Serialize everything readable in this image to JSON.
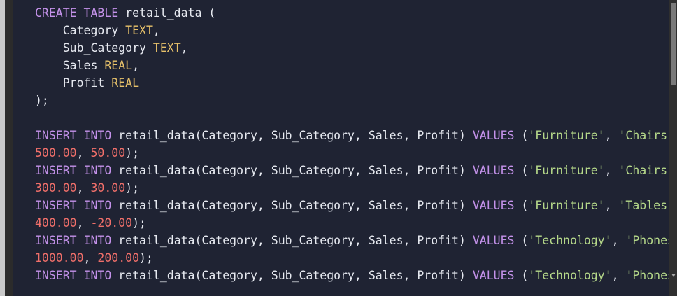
{
  "editor": {
    "lines": [
      [
        {
          "t": "CREATE TABLE ",
          "c": "kw"
        },
        {
          "t": "retail_data (",
          "c": ""
        }
      ],
      [
        {
          "t": "    Category ",
          "c": ""
        },
        {
          "t": "TEXT",
          "c": "ty"
        },
        {
          "t": ",",
          "c": ""
        }
      ],
      [
        {
          "t": "    Sub_Category ",
          "c": ""
        },
        {
          "t": "TEXT",
          "c": "ty"
        },
        {
          "t": ",",
          "c": ""
        }
      ],
      [
        {
          "t": "    Sales ",
          "c": ""
        },
        {
          "t": "REAL",
          "c": "ty"
        },
        {
          "t": ",",
          "c": ""
        }
      ],
      [
        {
          "t": "    Profit ",
          "c": ""
        },
        {
          "t": "REAL",
          "c": "ty"
        }
      ],
      [
        {
          "t": ");",
          "c": ""
        }
      ],
      [
        {
          "t": "",
          "c": ""
        }
      ],
      [
        {
          "t": "INSERT INTO ",
          "c": "kw"
        },
        {
          "t": "retail_data(Category, Sub_Category, Sales, Profit) ",
          "c": ""
        },
        {
          "t": "VALUES",
          "c": "kw"
        },
        {
          "t": " (",
          "c": ""
        },
        {
          "t": "'Furniture'",
          "c": "str"
        },
        {
          "t": ", ",
          "c": ""
        },
        {
          "t": "'Chairs'",
          "c": "str"
        },
        {
          "t": ",",
          "c": ""
        }
      ],
      [
        {
          "t": "500.00",
          "c": "num"
        },
        {
          "t": ", ",
          "c": ""
        },
        {
          "t": "50.00",
          "c": "num"
        },
        {
          "t": ");",
          "c": ""
        }
      ],
      [
        {
          "t": "INSERT INTO ",
          "c": "kw"
        },
        {
          "t": "retail_data(Category, Sub_Category, Sales, Profit) ",
          "c": ""
        },
        {
          "t": "VALUES",
          "c": "kw"
        },
        {
          "t": " (",
          "c": ""
        },
        {
          "t": "'Furniture'",
          "c": "str"
        },
        {
          "t": ", ",
          "c": ""
        },
        {
          "t": "'Chairs'",
          "c": "str"
        },
        {
          "t": ",",
          "c": ""
        }
      ],
      [
        {
          "t": "300.00",
          "c": "num"
        },
        {
          "t": ", ",
          "c": ""
        },
        {
          "t": "30.00",
          "c": "num"
        },
        {
          "t": ");",
          "c": ""
        }
      ],
      [
        {
          "t": "INSERT INTO ",
          "c": "kw"
        },
        {
          "t": "retail_data(Category, Sub_Category, Sales, Profit) ",
          "c": ""
        },
        {
          "t": "VALUES",
          "c": "kw"
        },
        {
          "t": " (",
          "c": ""
        },
        {
          "t": "'Furniture'",
          "c": "str"
        },
        {
          "t": ", ",
          "c": ""
        },
        {
          "t": "'Tables'",
          "c": "str"
        },
        {
          "t": ",",
          "c": ""
        }
      ],
      [
        {
          "t": "400.00",
          "c": "num"
        },
        {
          "t": ", ",
          "c": ""
        },
        {
          "t": "-20.00",
          "c": "num"
        },
        {
          "t": ");",
          "c": ""
        }
      ],
      [
        {
          "t": "INSERT INTO ",
          "c": "kw"
        },
        {
          "t": "retail_data(Category, Sub_Category, Sales, Profit) ",
          "c": ""
        },
        {
          "t": "VALUES",
          "c": "kw"
        },
        {
          "t": " (",
          "c": ""
        },
        {
          "t": "'Technology'",
          "c": "str"
        },
        {
          "t": ", ",
          "c": ""
        },
        {
          "t": "'Phones'",
          "c": "str"
        },
        {
          "t": ",",
          "c": ""
        }
      ],
      [
        {
          "t": "1000.00",
          "c": "num"
        },
        {
          "t": ", ",
          "c": ""
        },
        {
          "t": "200.00",
          "c": "num"
        },
        {
          "t": ");",
          "c": ""
        }
      ],
      [
        {
          "t": "INSERT INTO ",
          "c": "kw"
        },
        {
          "t": "retail_data(Category, Sub_Category, Sales, Profit) ",
          "c": ""
        },
        {
          "t": "VALUES",
          "c": "kw"
        },
        {
          "t": " (",
          "c": ""
        },
        {
          "t": "'Technology'",
          "c": "str"
        },
        {
          "t": ", ",
          "c": ""
        },
        {
          "t": "'Phones'",
          "c": "str"
        },
        {
          "t": ",",
          "c": ""
        }
      ]
    ]
  },
  "colors": {
    "background": "#1f2333",
    "keyword": "#c492ea",
    "type": "#e7c16a",
    "string": "#b6d98a",
    "number": "#f06f6a",
    "plain": "#e6e9f0"
  },
  "icons": {
    "scroll_down": "triangle-down-icon"
  }
}
